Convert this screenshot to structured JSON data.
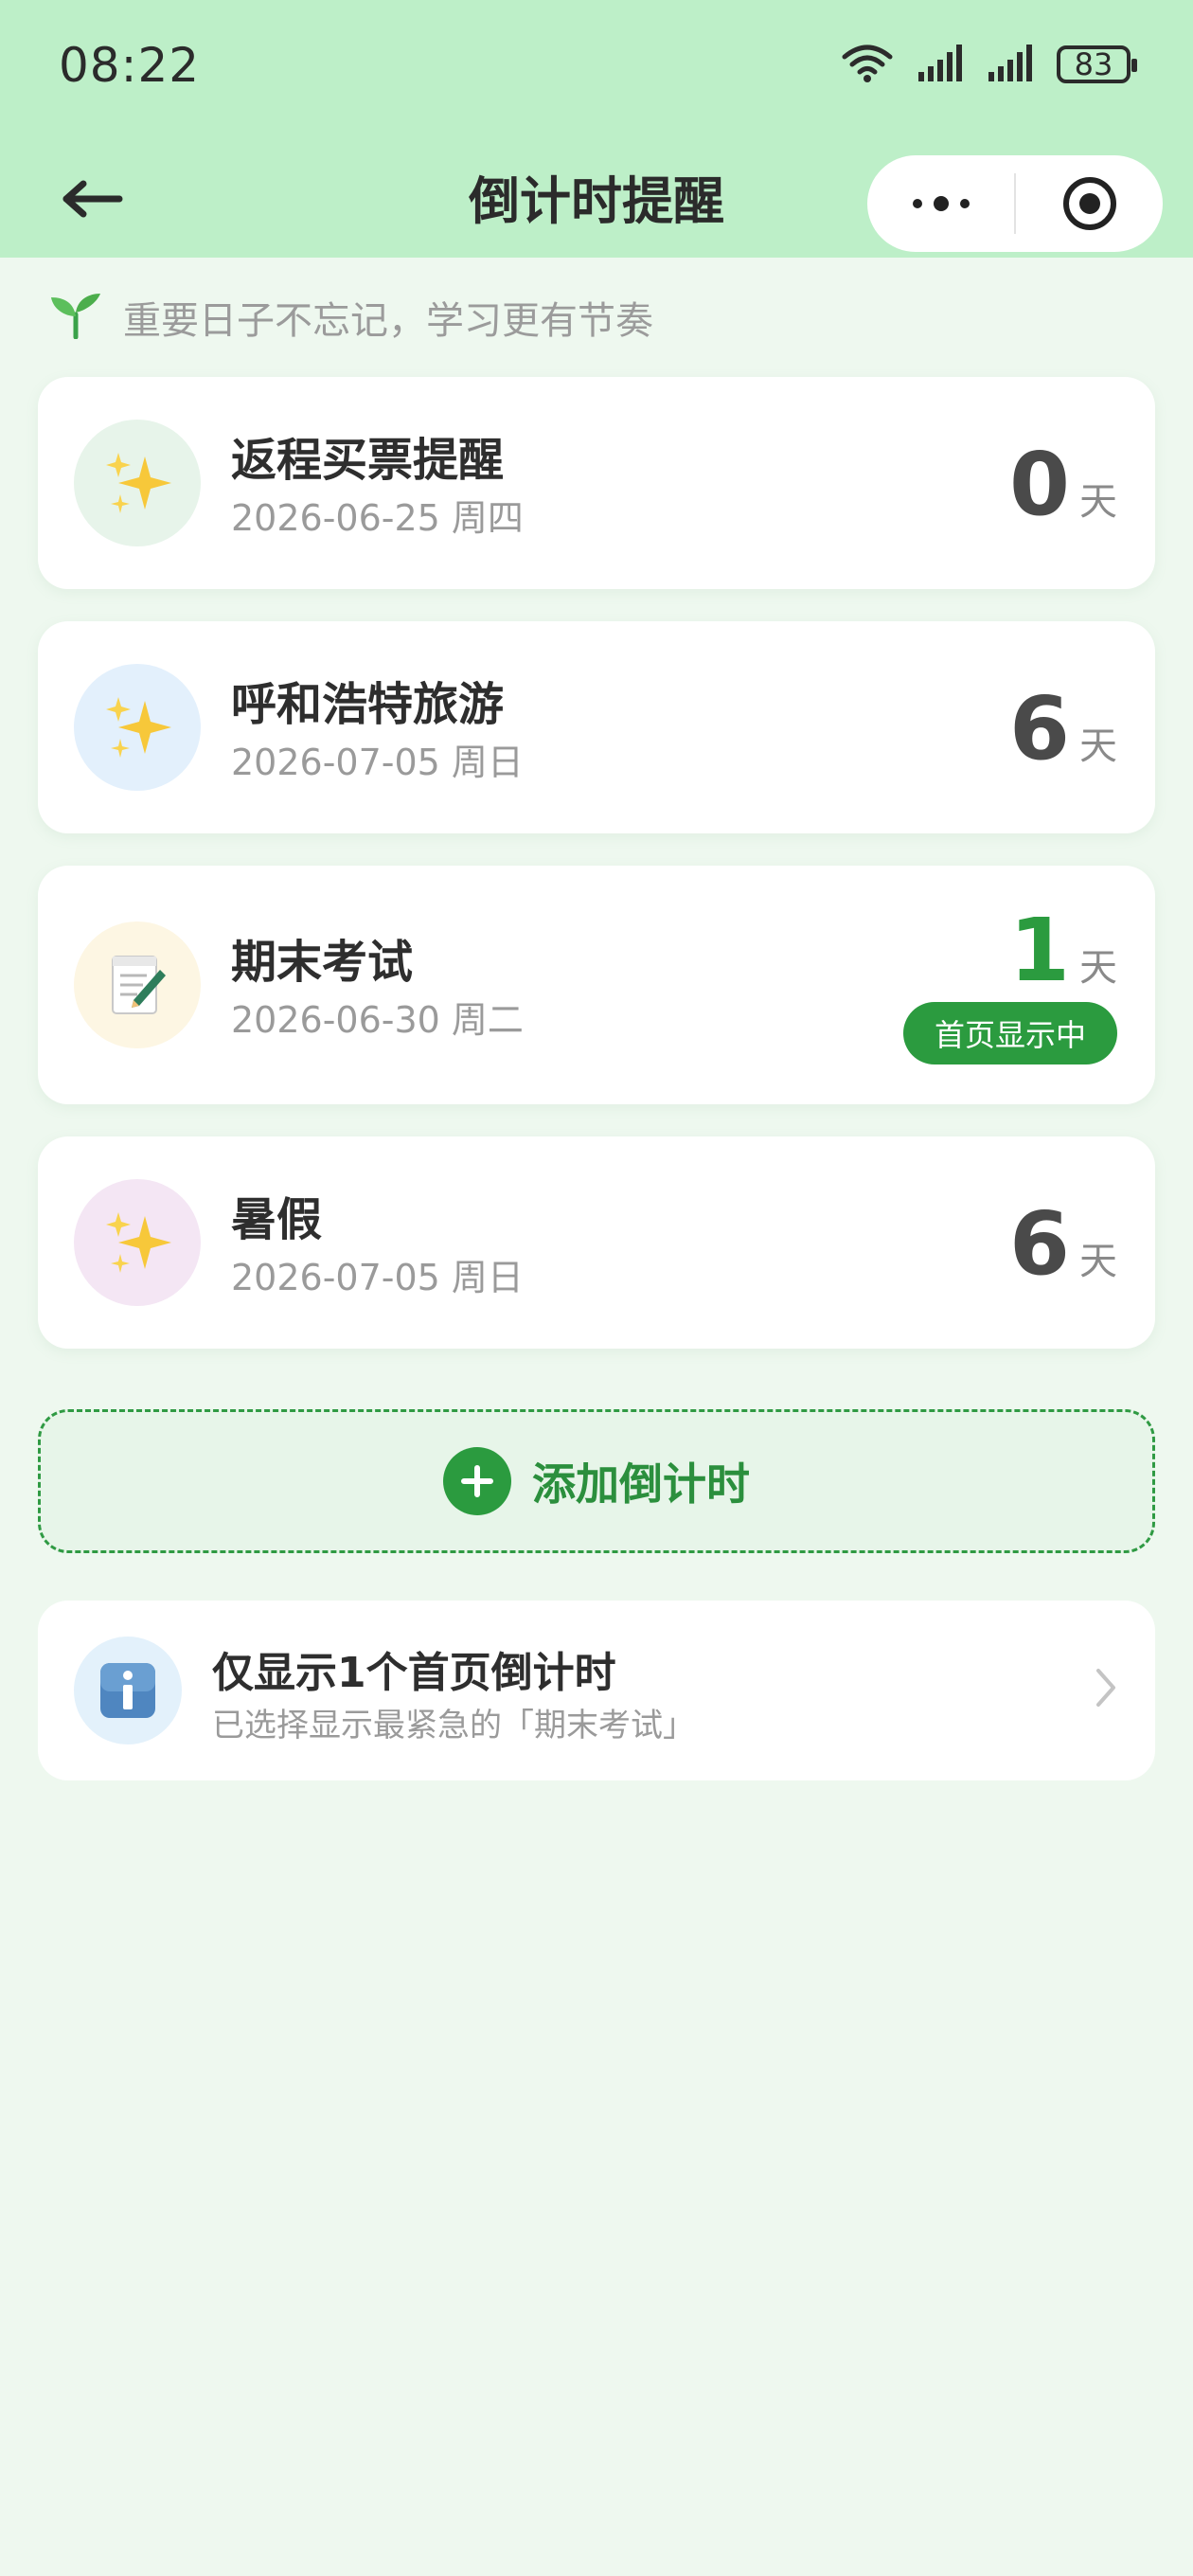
{
  "status_bar": {
    "time": "08:22",
    "battery": "83"
  },
  "nav": {
    "title": "倒计时提醒"
  },
  "slogan": {
    "text": "重要日子不忘记，学习更有节奏"
  },
  "countdowns": [
    {
      "title": "返程买票提醒",
      "date": "2026-06-25 周四",
      "days": "0",
      "unit": "天",
      "icon": "sparkles-icon",
      "icon_bg": "#e7f4ea"
    },
    {
      "title": "呼和浩特旅游",
      "date": "2026-07-05 周日",
      "days": "6",
      "unit": "天",
      "icon": "sparkles-icon",
      "icon_bg": "#e3f0fc"
    },
    {
      "title": "期末考试",
      "date": "2026-06-30 周二",
      "days": "1",
      "unit": "天",
      "icon": "memo-icon",
      "icon_bg": "#fdf6e3",
      "badge": "首页显示中"
    },
    {
      "title": "暑假",
      "date": "2026-07-05 周日",
      "days": "6",
      "unit": "天",
      "icon": "sparkles-icon",
      "icon_bg": "#f4e6f4"
    }
  ],
  "add_button": {
    "label": "添加倒计时"
  },
  "info": {
    "title": "仅显示1个首页倒计时",
    "subtitle": "已选择显示最紧急的「期末考试」"
  },
  "colors": {
    "accent": "#2b9b3f",
    "header_bg": "#bdefc8",
    "page_bg": "#eef8ef"
  }
}
